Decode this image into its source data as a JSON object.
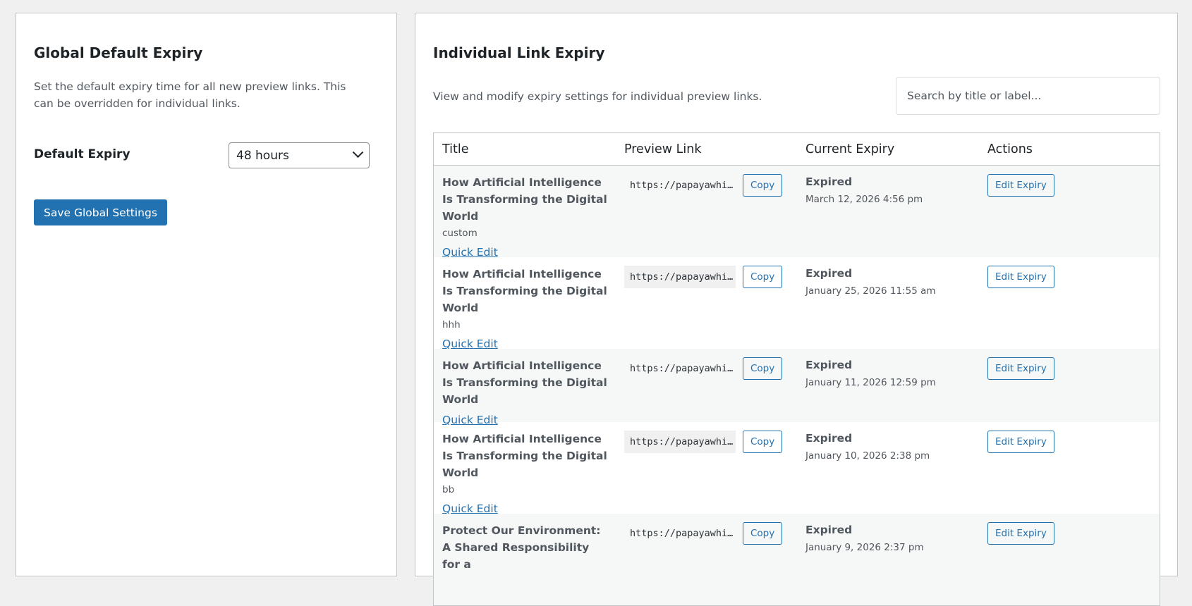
{
  "global": {
    "title": "Global Default Expiry",
    "description": "Set the default expiry time for all new preview links. This can be overridden for individual links.",
    "field_label": "Default Expiry",
    "select_value": "48 hours",
    "save_label": "Save Global Settings"
  },
  "individual": {
    "title": "Individual Link Expiry",
    "description": "View and modify expiry settings for individual preview links.",
    "search_placeholder": "Search by title or label...",
    "columns": [
      "Title",
      "Preview Link",
      "Current Expiry",
      "Actions"
    ],
    "rows": [
      {
        "title": "How Artificial Intelligence Is Transforming the Digital World",
        "label": "custom",
        "quick_edit": "Quick Edit",
        "link": "https://papayawhip...",
        "copy": "Copy",
        "status": "Expired",
        "date": "March 12, 2026 4:56 pm",
        "action": "Edit Expiry"
      },
      {
        "title": "How Artificial Intelligence Is Transforming the Digital World",
        "label": "hhh",
        "quick_edit": "Quick Edit",
        "link": "https://papayawhip...",
        "copy": "Copy",
        "status": "Expired",
        "date": "January 25, 2026 11:55 am",
        "action": "Edit Expiry"
      },
      {
        "title": "How Artificial Intelligence Is Transforming the Digital World",
        "label": "",
        "quick_edit": "Quick Edit",
        "link": "https://papayawhip...",
        "copy": "Copy",
        "status": "Expired",
        "date": "January 11, 2026 12:59 pm",
        "action": "Edit Expiry"
      },
      {
        "title": "How Artificial Intelligence Is Transforming the Digital World",
        "label": "bb",
        "quick_edit": "Quick Edit",
        "link": "https://papayawhip...",
        "copy": "Copy",
        "status": "Expired",
        "date": "January 10, 2026 2:38 pm",
        "action": "Edit Expiry"
      },
      {
        "title": "Protect Our Environment: A Shared Responsibility for a",
        "label": "",
        "quick_edit": "",
        "link": "https://papayawhip...",
        "copy": "Copy",
        "status": "Expired",
        "date": "January 9, 2026 2:37 pm",
        "action": "Edit Expiry"
      }
    ]
  },
  "colors": {
    "primary": "#2271b1",
    "background": "#f0f0f1",
    "row_alt": "#f6f7f7"
  }
}
